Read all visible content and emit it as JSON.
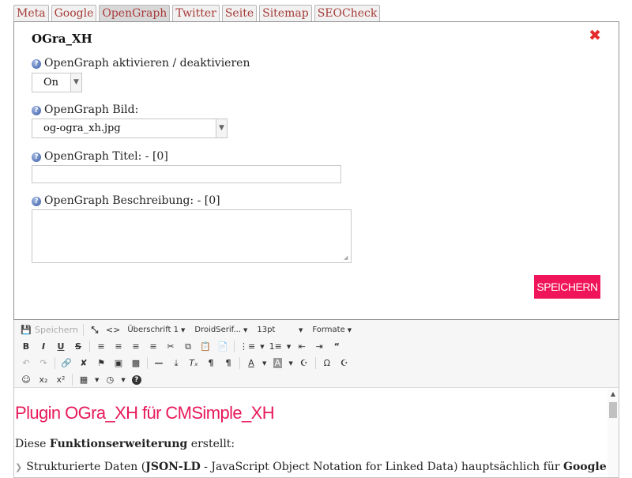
{
  "tabs": [
    "Meta",
    "Google",
    "OpenGraph",
    "Twitter",
    "Seite",
    "Sitemap",
    "SEOCheck"
  ],
  "active_tab": "OpenGraph",
  "panel": {
    "title": "OGra_XH",
    "close_symbol": "✖",
    "fields": {
      "activate_label": "OpenGraph aktivieren / deaktivieren",
      "activate_value": "On",
      "image_label": "OpenGraph Bild:",
      "image_value": "og-ogra_xh.jpg",
      "title_label": "OpenGraph Titel: - [0]",
      "title_value": "",
      "description_label": "OpenGraph Beschreibung: - [0]",
      "description_value": ""
    },
    "save_label": "SPEICHERN"
  },
  "editor": {
    "toolbar": {
      "save_label": "Speichern",
      "format_block": "Überschrift 1",
      "font_family": "DroidSerif...",
      "font_size": "13pt",
      "formats": "Formate"
    },
    "content": {
      "heading": "Plugin OGra_XH für CMSimple_XH",
      "para_prefix": "Diese ",
      "para_bold": "Funktionserweiterung",
      "para_suffix": " erstellt:",
      "li_prefix": "Strukturierte Daten (",
      "li_bold1": "JSON-LD",
      "li_middle": " - JavaScript Object Notation for Linked Data) hauptsächlich für ",
      "li_bold2": "Google"
    }
  },
  "colors": {
    "tab_text": "#a53b37",
    "close": "#e42a2a",
    "save_button": "#f0145a",
    "heading": "#e8195a"
  }
}
